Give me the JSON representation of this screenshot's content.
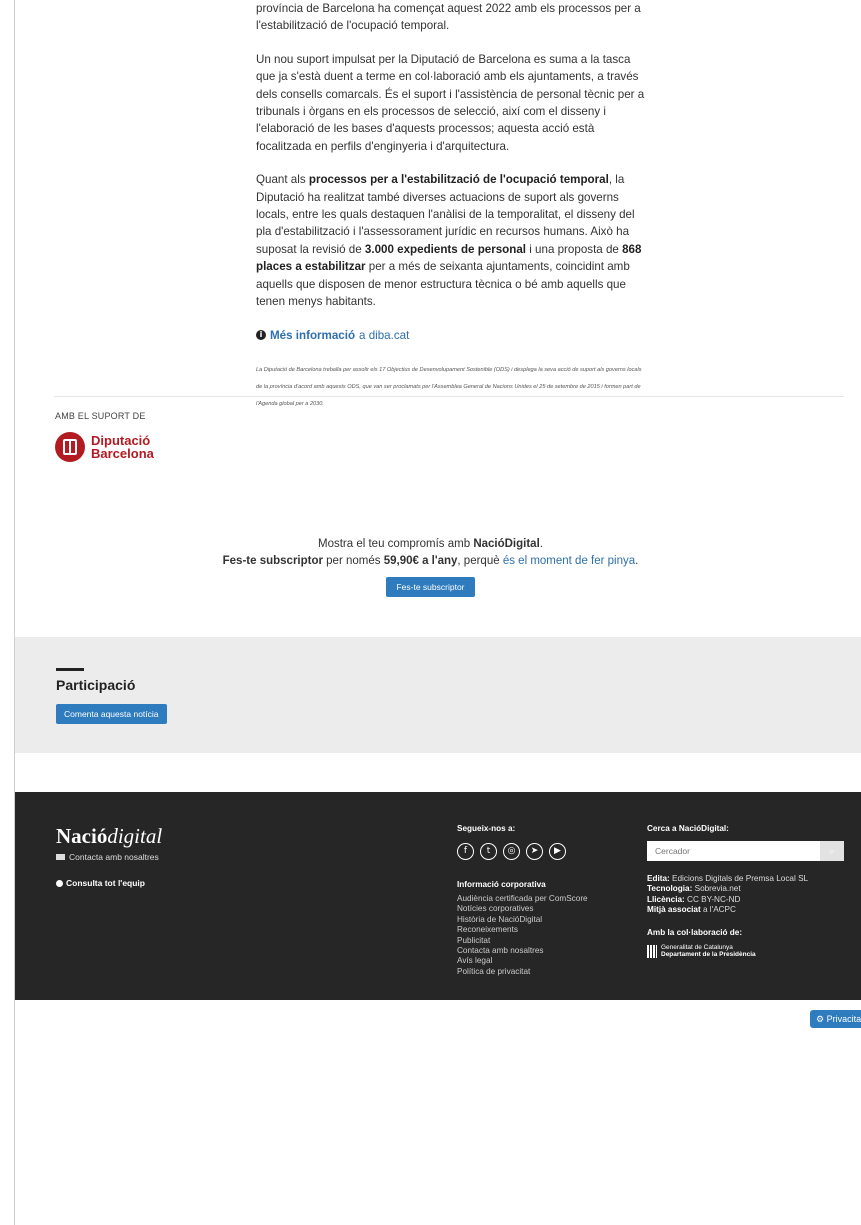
{
  "article": {
    "p1": "província de Barcelona ha començat aquest 2022 amb els processos per a l'estabilització de l'ocupació temporal.",
    "p2": "Un nou suport impulsat per la Diputació de Barcelona es suma a la tasca que ja s'està duent a terme en col·laboració amb els ajuntaments, a través dels consells comarcals. És el suport i l'assistència de personal tècnic per a tribunals i òrgans en els processos de selecció, així com el disseny i l'elaboració de les bases d'aquests processos; aquesta acció està focalitzada en perfils d'enginyeria i d'arquitectura.",
    "p3": {
      "a": "Quant als ",
      "b": "processos per a l'estabilització de l'ocupació temporal",
      "c": ", la Diputació ha realitzat també diverses actuacions de suport als governs locals, entre les quals destaquen l'anàlisi de la temporalitat, el disseny del pla d'estabilització i l'assessorament jurídic en recursos humans. Això ha suposat la revisió de ",
      "d": "3.000 expedients de personal",
      "e": " i una proposta de ",
      "f": "868 places a estabilitzar",
      "g": " per a més de seixanta ajuntaments, coincidint amb aquells que disposen de menor estructura tècnica o bé amb aquells que tenen menys habitants."
    },
    "more_link": "Més informació",
    "more_site": " a diba.cat",
    "fineprint": "La Diputació de Barcelona treballa per assolir els 17 Objectius de Desenvolupament Sostenible (ODS) i desplega la seva acció de suport als governs locals de la província d'acord amb aquests ODS, que van ser proclamats per l'Assemblea General de Nacions Unides el 25 de setembre de 2015 i formen part de l'Agenda global per a 2030."
  },
  "support": {
    "label": "AMB EL SUPORT DE",
    "logo_line1": "Diputació",
    "logo_line2": "Barcelona"
  },
  "subscribe": {
    "line1_a": "Mostra el teu compromís amb ",
    "line1_b": "NacióDigital",
    "line1_c": ".",
    "line2_a": "Fes-te subscriptor",
    "line2_b": " per només ",
    "line2_c": "59,90€ a l'any",
    "line2_d": ", perquè ",
    "line2_link": "és el moment de fer pinya",
    "line2_e": ".",
    "button": "Fes-te subscriptor"
  },
  "participacio": {
    "title": "Participació",
    "button": "Comenta aquesta notícia"
  },
  "footer": {
    "brand_bold": "Nació",
    "brand_italic": "digital",
    "contact": "Contacta amb nosaltres",
    "team": "Consulta tot l'equip",
    "follow": "Segueix-nos a:",
    "corporate_title": "Informació corporativa",
    "corporate_links": [
      "Audiència certificada per ComScore",
      "Notícies corporatives",
      "Història de NacióDigital",
      "Reconeixements",
      "Publicitat",
      "Contacta amb nosaltres",
      "Avís legal",
      "Política de privacitat"
    ],
    "search_title": "Cerca a NacióDigital:",
    "search_placeholder": "Cercador",
    "edita_label": "Edita:",
    "edita_value": " Edicions Digitals de Premsa Local SL",
    "tech_label": "Tecnologia:",
    "tech_value": " Sobrevia.net",
    "lic_label": "Llicència:",
    "lic_value": " CC BY-NC-ND",
    "mitja_label": "Mitjà associat",
    "mitja_value": " a l'ACPC",
    "collab_title": "Amb la col·laboració de:",
    "gencat_line1": "Generalitat de Catalunya",
    "gencat_line2": "Departament de la Presidència"
  },
  "privacy_button": "Privacitat",
  "colors": {
    "accent": "#2e7bbd",
    "link": "#2e6fad",
    "brand_red": "#b31b22",
    "footer_bg": "#262626"
  }
}
